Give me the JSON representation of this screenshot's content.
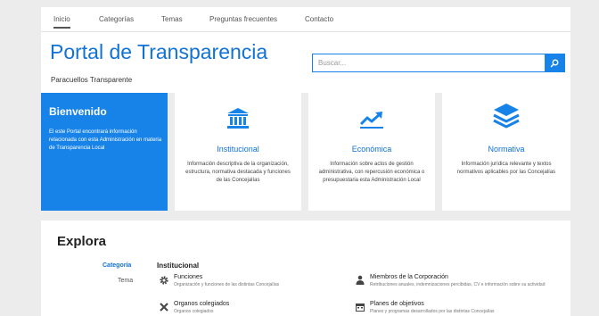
{
  "nav": {
    "items": [
      {
        "label": "Inicio",
        "active": true
      },
      {
        "label": "Categorías",
        "active": false
      },
      {
        "label": "Temas",
        "active": false
      },
      {
        "label": "Preguntas frecuentes",
        "active": false
      },
      {
        "label": "Contacto",
        "active": false
      }
    ]
  },
  "header": {
    "title": "Portal de Transparencia",
    "subtitle": "Paracuellos Transparente"
  },
  "search": {
    "placeholder": "Buscar...",
    "value": "",
    "button_icon": "search-icon"
  },
  "welcome": {
    "title": "Bienvenido",
    "text": "El este Portal encontrará información relacionada con esta Administración en materia de Transparencia Local"
  },
  "cards": [
    {
      "icon": "institution-icon",
      "title": "Institucional",
      "desc": "Información descriptiva de la organización, estructura, normativa destacada y funciones de las Concejalías"
    },
    {
      "icon": "trending-up-icon",
      "title": "Económica",
      "desc": "Información sobre actos de gestión administrativa, con repercusión económica o presupuestaria esta Administración Local"
    },
    {
      "icon": "layers-icon",
      "title": "Normativa",
      "desc": "Información jurídica relevante y textos normativos aplicables por las Concejalías"
    }
  ],
  "explora": {
    "title": "Explora",
    "filters": {
      "categoria": "Categoría",
      "tema": "Tema"
    },
    "section": "Institucional",
    "items": [
      {
        "icon": "gears-icon",
        "title": "Funciones",
        "desc": "Organización y funciones de las distintas Concejalías"
      },
      {
        "icon": "people-icon",
        "title": "Miembros de la Corporación",
        "desc": "Retribuciones anuales, indemnizaciones percibidas, CV e información sobre su actividad"
      },
      {
        "icon": "tools-icon",
        "title": "Organos colegiados",
        "desc": "Organos colegiados"
      },
      {
        "icon": "calendar-icon",
        "title": "Planes de objetivos",
        "desc": "Planes y programas desarrollados por las distintas Concejalías"
      }
    ]
  },
  "colors": {
    "accent": "#1783e8",
    "title_blue": "#1172d6",
    "background": "#ececec"
  }
}
